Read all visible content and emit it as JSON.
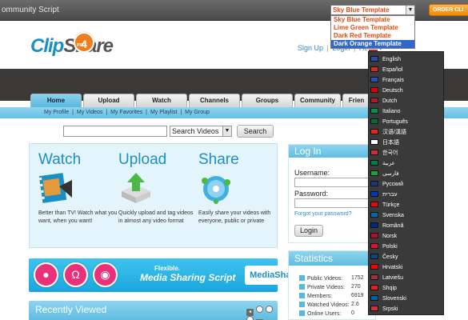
{
  "topbar": {
    "title": "ommunity Script",
    "order_label": "ORDER CLI"
  },
  "template_select": {
    "selected": "Sky Blue Template",
    "options": [
      "Sky Blue Template",
      "Lime Green Template",
      "Dark Red Template",
      "Dark Orange Template"
    ],
    "highlighted_index": 3
  },
  "logo": {
    "part1": "Clip",
    "part2": "Share",
    "badge": "4",
    "badge_small": "PRO"
  },
  "userlinks": {
    "signup": "Sign Up",
    "login": "Login",
    "help": "Help"
  },
  "nav": {
    "tabs": [
      "Home",
      "Upload",
      "Watch",
      "Channels",
      "Groups",
      "Community",
      "Frien"
    ],
    "active": 0,
    "subnav": [
      "My Profile",
      "My Videos",
      "My Favorites",
      "My Playlist",
      "My Group"
    ]
  },
  "search": {
    "select_value": "Search Videos",
    "button": "Search"
  },
  "features": [
    {
      "title": "Watch",
      "text": "Better than TV! Watch what you want, when you want!",
      "icon": "film-icon"
    },
    {
      "title": "Upload",
      "text": "Quickly upload and tag videos in almost any video format",
      "icon": "upload-arrow-icon"
    },
    {
      "title": "Share",
      "text": "Easily share your videos with everyone, public or private",
      "icon": "globe-share-icon"
    }
  ],
  "media_banner": {
    "line1": "Flexible.",
    "line2": "Media Sharing Script",
    "brand": "MediaShare"
  },
  "recent": {
    "title": "Recently Viewed"
  },
  "login": {
    "title": "Log In",
    "username_label": "Username:",
    "password_label": "Password:",
    "forgot": "Forgot your password?",
    "button": "Login"
  },
  "stats": {
    "title": "Statistics",
    "rows": [
      {
        "label": "Public Videos:",
        "value": "1752"
      },
      {
        "label": "Private Videos:",
        "value": "270"
      },
      {
        "label": "Members:",
        "value": "6919"
      },
      {
        "label": "Watched Videos:",
        "value": "2.6"
      },
      {
        "label": "Online Users:",
        "value": "0"
      }
    ]
  },
  "languages": [
    {
      "name": "English",
      "color": "#2c4fa3"
    },
    {
      "name": "Español",
      "color": "#d52b1e"
    },
    {
      "name": "Français",
      "color": "#2f4fb0"
    },
    {
      "name": "Deutsch",
      "color": "#dd0000"
    },
    {
      "name": "Dutch",
      "color": "#ae1c28"
    },
    {
      "name": "Italiano",
      "color": "#009246"
    },
    {
      "name": "Português",
      "color": "#046a38"
    },
    {
      "name": "汉语/漢語",
      "color": "#de2910"
    },
    {
      "name": "日本語",
      "color": "#ffffff"
    },
    {
      "name": "한국어",
      "color": "#cd2e3a"
    },
    {
      "name": "عربية",
      "color": "#007a3d"
    },
    {
      "name": "فارسی",
      "color": "#239f40"
    },
    {
      "name": "Русский",
      "color": "#1c3578"
    },
    {
      "name": "עברית",
      "color": "#0038b8"
    },
    {
      "name": "Türkçe",
      "color": "#e30a17"
    },
    {
      "name": "Svenska",
      "color": "#006aa7"
    },
    {
      "name": "Română",
      "color": "#002b7f"
    },
    {
      "name": "Norsk",
      "color": "#ba0c2f"
    },
    {
      "name": "Polski",
      "color": "#dc143c"
    },
    {
      "name": "Česky",
      "color": "#11457e"
    },
    {
      "name": "Hrvatski",
      "color": "#ff0000"
    },
    {
      "name": "Latviešu",
      "color": "#9e3039"
    },
    {
      "name": "Shqip",
      "color": "#e41e20"
    },
    {
      "name": "Slovenski",
      "color": "#005da4"
    },
    {
      "name": "Srpski",
      "color": "#c6363c"
    }
  ]
}
